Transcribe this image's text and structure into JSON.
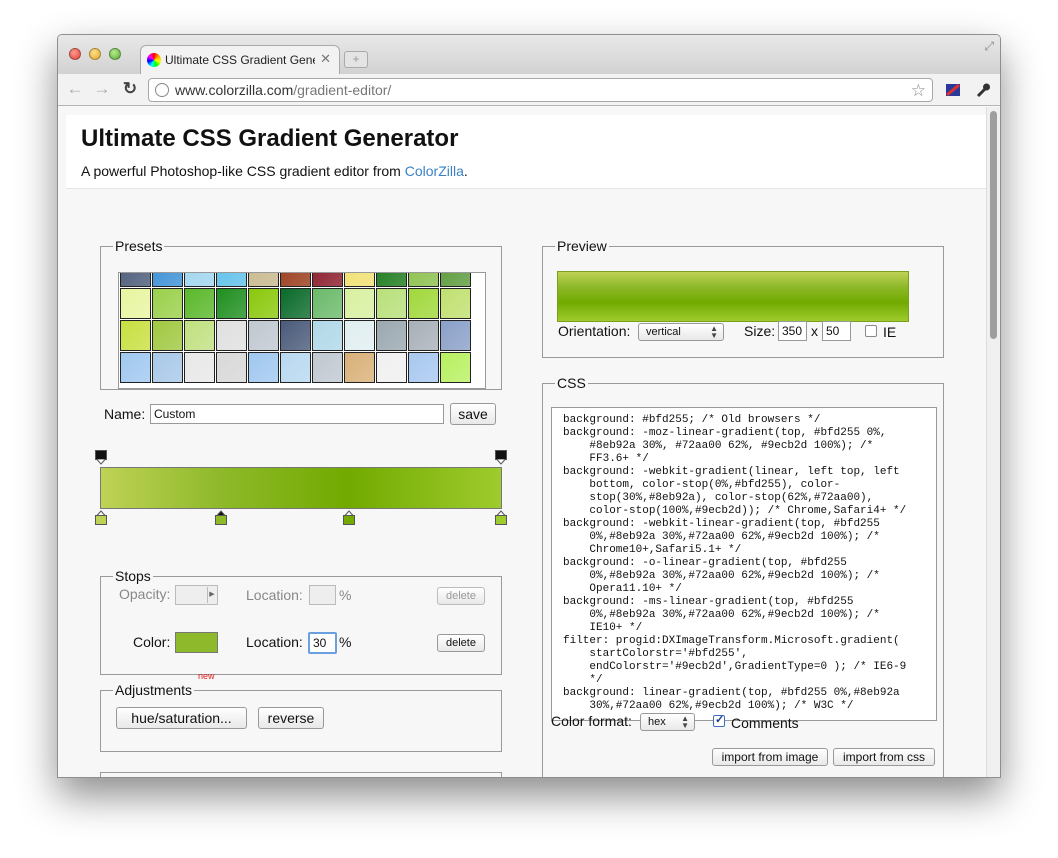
{
  "browser": {
    "tab_title": "Ultimate CSS Gradient Genera",
    "tab_close": "✕",
    "new_tab": "+",
    "url_host": "www.colorzilla.com",
    "url_path": "/gradient-editor/",
    "back_icon": "back-arrow-icon",
    "forward_icon": "forward-arrow-icon",
    "reload_icon": "reload-icon"
  },
  "page": {
    "title": "Ultimate CSS Gradient Generator",
    "subtitle_pre": "A powerful Photoshop-like CSS gradient editor from ",
    "subtitle_link": "ColorZilla",
    "subtitle_post": "."
  },
  "presets": {
    "legend": "Presets",
    "rows": [
      [
        "#4a5a78",
        "#3a8fd6",
        "#9fd5ef",
        "#5ec0ea",
        "#c8b98c",
        "#9a3a1a",
        "#8a1a2a",
        "#f0e070",
        "#1a7a1a",
        "#8ac04a",
        "#5a9a3a"
      ],
      [
        "#e8f5a0",
        "#9ad04a",
        "#5ab82a",
        "#1f8f1f",
        "#8ac80a",
        "#0a6a2a",
        "#6aba6a",
        "#d8f0a0",
        "#b8e07a",
        "#a0d83a",
        "#c0e070"
      ],
      [
        "#c8e040",
        "#a0c840",
        "#c0e080",
        "#e0e0e0",
        "#c0c8d0",
        "#4a5a7a",
        "#b0d8e8",
        "#e0eef0",
        "#9aa8b0",
        "#a8b0b8",
        "#8aa0c8"
      ],
      [
        "#a0c8f0",
        "#a8c8e8",
        "#e8e8e8",
        "#d8d8d8",
        "#a0c8f0",
        "#b8d8f0",
        "#c0c8d0",
        "#d8b078",
        "#f0f0f0",
        "#a8c8f0",
        "#b8f060"
      ]
    ]
  },
  "name": {
    "label": "Name:",
    "value": "Custom",
    "save": "save"
  },
  "gradient": {
    "stops": [
      {
        "color": "#bfd255",
        "position": 0
      },
      {
        "color": "#8eb92a",
        "position": 30
      },
      {
        "color": "#72aa00",
        "position": 62
      },
      {
        "color": "#9ecb2d",
        "position": 100
      }
    ]
  },
  "stops_panel": {
    "legend": "Stops",
    "opacity_label": "Opacity:",
    "location_label": "Location:",
    "percent": "%",
    "delete": "delete",
    "color_label": "Color:",
    "color_swatch": "#8eb92a",
    "location_value": "30"
  },
  "adjustments": {
    "legend": "Adjustments",
    "new_tag": "new",
    "hue_button": "hue/saturation...",
    "reverse_button": "reverse"
  },
  "preview": {
    "legend": "Preview",
    "orientation_label": "Orientation:",
    "orientation_value": "vertical",
    "size_label": "Size:",
    "width": "350",
    "x": "x",
    "height": "50",
    "ie_label": "IE"
  },
  "css_panel": {
    "legend": "CSS",
    "code": "background: #bfd255; /* Old browsers */\nbackground: -moz-linear-gradient(top, #bfd255 0%,\n    #8eb92a 30%, #72aa00 62%, #9ecb2d 100%); /*\n    FF3.6+ */\nbackground: -webkit-gradient(linear, left top, left\n    bottom, color-stop(0%,#bfd255), color-\n    stop(30%,#8eb92a), color-stop(62%,#72aa00),\n    color-stop(100%,#9ecb2d)); /* Chrome,Safari4+ */\nbackground: -webkit-linear-gradient(top, #bfd255\n    0%,#8eb92a 30%,#72aa00 62%,#9ecb2d 100%); /*\n    Chrome10+,Safari5.1+ */\nbackground: -o-linear-gradient(top, #bfd255\n    0%,#8eb92a 30%,#72aa00 62%,#9ecb2d 100%); /*\n    Opera11.10+ */\nbackground: -ms-linear-gradient(top, #bfd255\n    0%,#8eb92a 30%,#72aa00 62%,#9ecb2d 100%); /*\n    IE10+ */\nfilter: progid:DXImageTransform.Microsoft.gradient(\n    startColorstr='#bfd255',\n    endColorstr='#9ecb2d',GradientType=0 ); /* IE6-9\n    */\nbackground: linear-gradient(top, #bfd255 0%,#8eb92a\n    30%,#72aa00 62%,#9ecb2d 100%); /* W3C */",
    "color_format_label": "Color format:",
    "color_format_value": "hex",
    "comments_label": "Comments",
    "comments_checked": true,
    "import_image": "import from image",
    "import_css": "import from css"
  }
}
